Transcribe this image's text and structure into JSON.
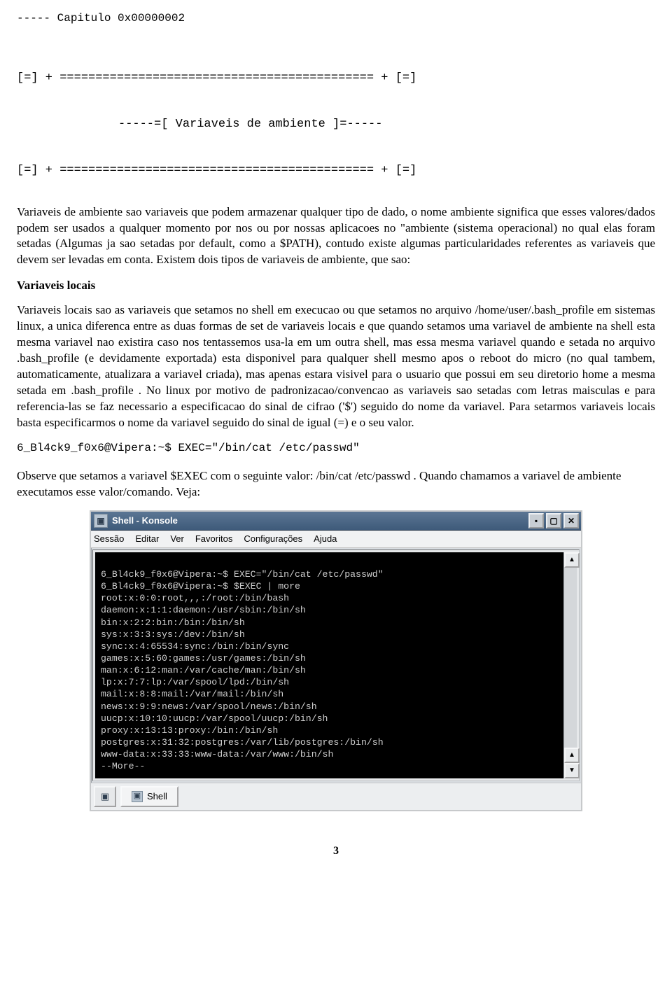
{
  "chapter_line": "----- Capitulo 0x00000002",
  "banner": {
    "line1": "[=] + ============================================ + [=]",
    "title": "-----=[ Variaveis de ambiente ]=-----",
    "line2": "[=] + ============================================ + [=]"
  },
  "para_intro": "Variaveis de ambiente sao variaveis que podem armazenar qualquer tipo de dado, o nome ambiente significa que esses valores/dados podem ser usados a qualquer momento por nos ou por nossas aplicacoes no \"ambiente (sistema operacional) no qual elas foram setadas (Algumas ja sao setadas por default, como a $PATH), contudo existe algumas particularidades referentes as variaveis que devem ser levadas em conta. Existem dois tipos de variaveis de ambiente, que sao:",
  "subhead1": "Variaveis locais",
  "para_locais": "Variaveis locais sao as variaveis que setamos no shell em execucao ou que setamos no arquivo /home/user/.bash_profile em sistemas linux, a unica diferenca entre as duas formas de set de variaveis locais e que quando setamos uma variavel de ambiente na shell esta mesma variavel nao existira caso nos tentassemos usa-la em um outra shell, mas essa mesma variavel quando e setada no arquivo .bash_profile (e devidamente exportada) esta disponivel para qualquer shell mesmo apos o reboot do micro (no qual tambem, automaticamente, atualizara a variavel criada), mas apenas estara visivel para o usuario que possui em seu diretorio home a mesma setada em .bash_profile . No linux por motivo de padronizacao/convencao  as variaveis sao setadas com letras maisculas e para referencia-las se faz necessario a especificacao do sinal de cifrao ('$') seguido do nome da variavel. Para setarmos variaveis locais basta especificarmos o nome da variavel seguido do sinal de igual (=) e o seu valor.",
  "command1": "6_Bl4ck9_f0x6@Vipera:~$ EXEC=\"/bin/cat /etc/passwd\"",
  "para_observe": "Observe que setamos a variavel $EXEC com o seguinte valor: /bin/cat /etc/passwd . Quando chamamos a variavel de ambiente executamos esse valor/comando. Veja:",
  "konsole": {
    "title": "Shell - Konsole",
    "menus": [
      "Sessão",
      "Editar",
      "Ver",
      "Favoritos",
      "Configurações",
      "Ajuda"
    ],
    "tab_label": "Shell",
    "lines": [
      "",
      "6_Bl4ck9_f0x6@Vipera:~$ EXEC=\"/bin/cat /etc/passwd\"",
      "6_Bl4ck9_f0x6@Vipera:~$ $EXEC | more",
      "root:x:0:0:root,,,:/root:/bin/bash",
      "daemon:x:1:1:daemon:/usr/sbin:/bin/sh",
      "bin:x:2:2:bin:/bin:/bin/sh",
      "sys:x:3:3:sys:/dev:/bin/sh",
      "sync:x:4:65534:sync:/bin:/bin/sync",
      "games:x:5:60:games:/usr/games:/bin/sh",
      "man:x:6:12:man:/var/cache/man:/bin/sh",
      "lp:x:7:7:lp:/var/spool/lpd:/bin/sh",
      "mail:x:8:8:mail:/var/mail:/bin/sh",
      "news:x:9:9:news:/var/spool/news:/bin/sh",
      "uucp:x:10:10:uucp:/var/spool/uucp:/bin/sh",
      "proxy:x:13:13:proxy:/bin:/bin/sh",
      "postgres:x:31:32:postgres:/var/lib/postgres:/bin/sh",
      "www-data:x:33:33:www-data:/var/www:/bin/sh",
      "--More--"
    ]
  },
  "page_number": "3"
}
